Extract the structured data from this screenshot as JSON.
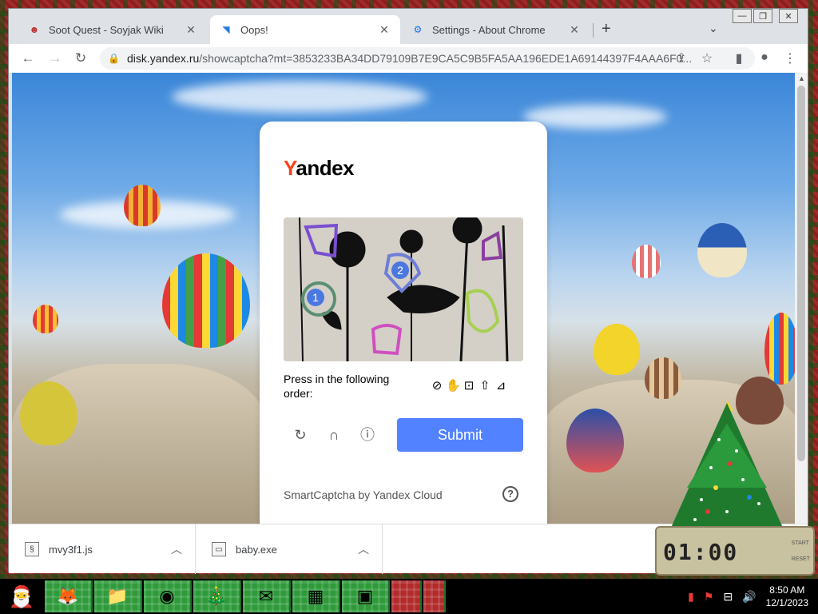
{
  "browser": {
    "tabs": [
      {
        "title": "Soot Quest - Soyjak Wiki",
        "active": false,
        "icon": "wiki-favicon"
      },
      {
        "title": "Oops!",
        "active": true,
        "icon": "yandex-favicon"
      },
      {
        "title": "Settings - About Chrome",
        "active": false,
        "icon": "gear-icon"
      }
    ],
    "new_tab": "+",
    "url_host": "disk.yandex.ru",
    "url_path": "/showcaptcha?mt=3853233BA34DD79109B7E9CA5C9B5FA5AA196EDE1A69144397F4AAA6F0..."
  },
  "captcha": {
    "logo_first": "Y",
    "logo_rest": "andex",
    "order_label": "Press in the following order:",
    "order_icons": [
      "compass-icon",
      "hand-icon",
      "lock-icon",
      "arrow-up-icon",
      "chart-icon"
    ],
    "submit_label": "Submit",
    "footer": "SmartCaptcha by Yandex Cloud",
    "markers": [
      "1",
      "2"
    ],
    "colors": {
      "submit": "#5282ff",
      "logo_red": "#fc3f1d"
    }
  },
  "downloads": [
    {
      "name": "mvy3f1.js"
    },
    {
      "name": "baby.exe"
    }
  ],
  "widget": {
    "clock": "01:00",
    "start": "START",
    "reset": "RESET"
  },
  "taskbar": {
    "time": "8:50 AM",
    "date": "12/1/2023",
    "apps": [
      "firefox-icon",
      "file-explorer-icon",
      "chrome-icon",
      "tree-icon",
      "thunderbird-icon",
      "calculator-icon",
      "photos-icon"
    ]
  }
}
